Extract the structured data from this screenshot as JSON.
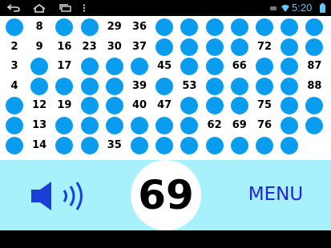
{
  "status_bar": {
    "time": "5:20",
    "icons": [
      "back-icon",
      "home-icon",
      "recent-apps-icon",
      "overflow-menu-icon",
      "notification-icon",
      "wifi-icon",
      "battery-icon"
    ]
  },
  "board": {
    "columns": 13,
    "rows": 7,
    "called_numbers": [
      2,
      3,
      4,
      8,
      9,
      12,
      13,
      14,
      16,
      17,
      19,
      23,
      29,
      30,
      35,
      36,
      37,
      39,
      40,
      45,
      47,
      53,
      62,
      66,
      69,
      72,
      75,
      76,
      87,
      88
    ]
  },
  "current_number": "69",
  "menu_label": "MENU",
  "colors": {
    "ball_uncalled": "#0a9cee",
    "ball_called": "#ffffff",
    "panel_background": "#a6f1fb",
    "menu_text": "#2222dd",
    "status_time": "#5ec8ff"
  }
}
